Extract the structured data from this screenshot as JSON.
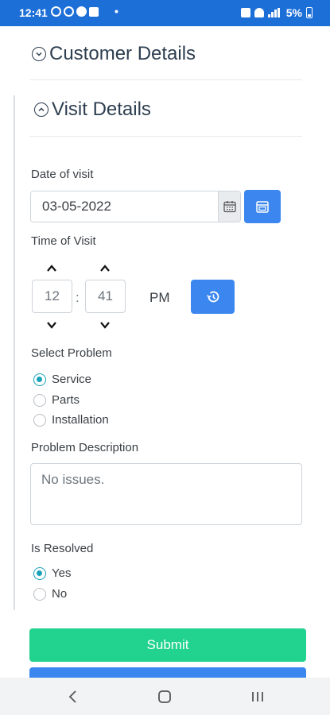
{
  "status_bar": {
    "time": "12:41",
    "bullet": "•",
    "battery": "5%",
    "icons": [
      "whatsapp-icon",
      "whatsapp-business-icon",
      "messenger-icon",
      "message-icon",
      "alarm-icon",
      "wifi-icon",
      "signal-icon",
      "battery-icon"
    ]
  },
  "sections": {
    "customer_details": "Customer Details",
    "visit_details": "Visit Details"
  },
  "form": {
    "date_label": "Date of visit",
    "date_value": "03-05-2022",
    "time_label": "Time of Visit",
    "hour": "12",
    "separator": ":",
    "minute": "41",
    "meridian": "PM",
    "problem_label": "Select Problem",
    "problem_options": [
      "Service",
      "Parts",
      "Installation"
    ],
    "problem_selected": "Service",
    "description_label": "Problem Description",
    "description_value": "No issues.",
    "resolved_label": "Is Resolved",
    "resolved_options": [
      "Yes",
      "No"
    ],
    "resolved_selected": "Yes",
    "submit_label": "Submit"
  },
  "colors": {
    "status_bar": "#1d6fd8",
    "primary": "#3b87ef",
    "success": "#21d38f",
    "radio_checked": "#17a2b8"
  }
}
